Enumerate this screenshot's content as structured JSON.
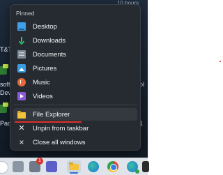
{
  "menu": {
    "header": "Pinned",
    "pinned_items": [
      {
        "label": "Desktop",
        "icon": "desktop-icon"
      },
      {
        "label": "Downloads",
        "icon": "download-icon"
      },
      {
        "label": "Documents",
        "icon": "documents-icon"
      },
      {
        "label": "Pictures",
        "icon": "pictures-icon"
      },
      {
        "label": "Music",
        "icon": "music-icon"
      },
      {
        "label": "Videos",
        "icon": "videos-icon"
      }
    ],
    "actions": [
      {
        "label": "File Explorer",
        "icon": "folder-icon"
      },
      {
        "label": "Unpin from taskbar",
        "icon": "unpin-icon"
      },
      {
        "label": "Close all windows",
        "icon": "close-icon"
      }
    ]
  },
  "desktop_fragments": {
    "f1": "T&T",
    "f2": "soft",
    "f3": "Dev",
    "f4": "Pad",
    "f5": "ol",
    "f6": "1",
    "f7": "10 hours"
  },
  "taskbar": {
    "badge_count": "1"
  },
  "colors": {
    "menu_bg": "#262b31",
    "underline": "#e0302b",
    "taskbar_bg": "#dfe4ea"
  }
}
